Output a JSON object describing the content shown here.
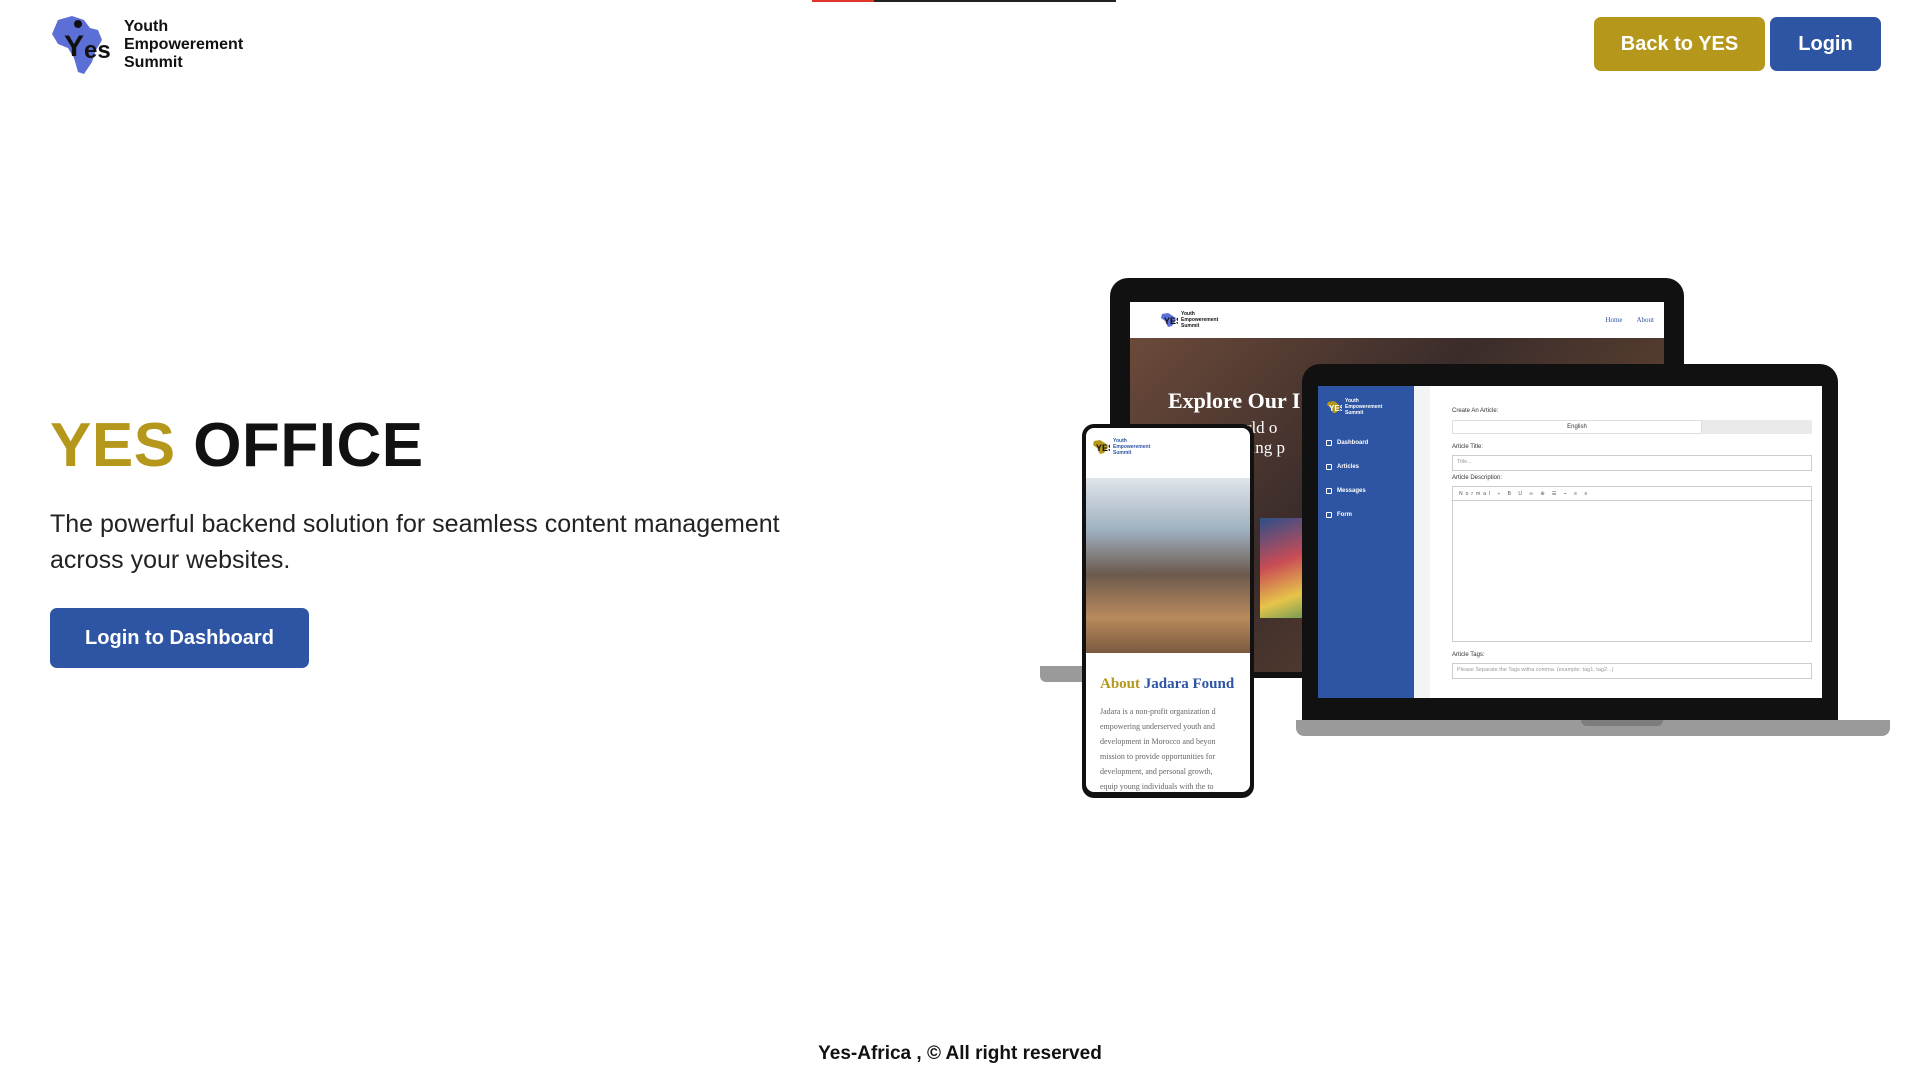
{
  "header": {
    "logo_lines": [
      "Youth",
      "Empowerement",
      "Summit"
    ],
    "back_button": "Back to YES",
    "login_button": "Login"
  },
  "hero": {
    "title_accent": "YES",
    "title_rest": "OFFICE",
    "subtitle": "The powerful backend solution for seamless content management across your websites.",
    "cta": "Login to Dashboard"
  },
  "illustration": {
    "site_nav_links": [
      "Home",
      "About"
    ],
    "site_hero_title": "Explore Our I",
    "site_hero_text": [
      "world o",
      "voking p"
    ],
    "dashboard_sidebar": [
      "Dashboard",
      "Articles",
      "Messages",
      "Form"
    ],
    "dashboard_form": {
      "heading": "Create An Article:",
      "language": "English",
      "title_label": "Article Title:",
      "title_placeholder": "Title...",
      "description_label": "Article Description:",
      "toolbar": "Normal ÷ B U ∞ ⊕ ☰ ⌁ ≡ ≡",
      "tags_label": "Article Tags:",
      "tags_placeholder": "Please Separate the Tags witha comma. (example: tag1, tag2...)"
    },
    "phone_heading_accent": "About",
    "phone_heading_rest": "Jadara Found",
    "phone_text": [
      "Jadara is a non-profit organization d",
      "empowering underserved youth and",
      "development in Morocco and beyon",
      "mission to provide opportunities for",
      "development, and personal growth,",
      "equip young individuals with the to"
    ]
  },
  "footer": {
    "text": "Yes-Africa , © All right reserved"
  },
  "colors": {
    "gold": "#b5981b",
    "blue": "#2d55a3"
  }
}
